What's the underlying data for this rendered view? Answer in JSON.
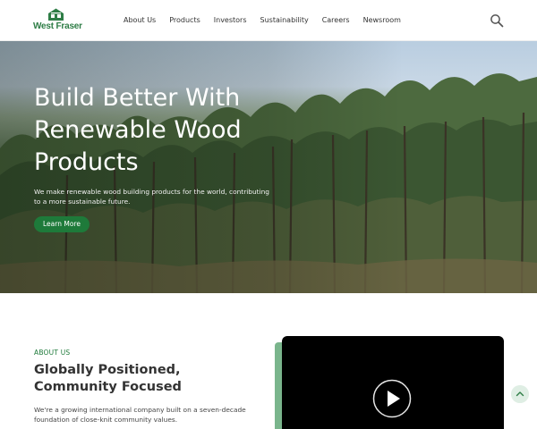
{
  "brand": {
    "name": "West Fraser",
    "color": "#2e7d46"
  },
  "nav": {
    "items": [
      {
        "label": "About Us"
      },
      {
        "label": "Products"
      },
      {
        "label": "Investors"
      },
      {
        "label": "Sustainability"
      },
      {
        "label": "Careers"
      },
      {
        "label": "Newsroom"
      }
    ],
    "search_icon": "search-icon"
  },
  "hero": {
    "title": "Build Better With Renewable Wood Products",
    "subtitle": "We make renewable wood building products for the world, contributing to a more sustainable future.",
    "cta_label": "Learn More",
    "cta_color": "#1e7a3a"
  },
  "about": {
    "label": "ABOUT US",
    "title": "Globally Positioned, Community Focused",
    "body": "We're a growing international company built on a seven-decade foundation of close-knit community values."
  },
  "video": {
    "play_icon": "play-icon"
  },
  "scroll_top": {
    "icon": "chevron-up-icon"
  }
}
